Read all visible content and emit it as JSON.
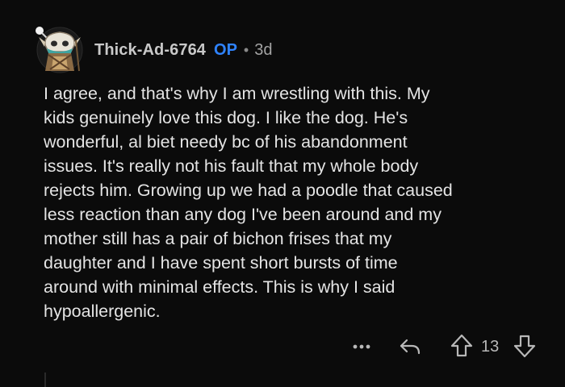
{
  "comment": {
    "author": "Thick-Ad-6764",
    "op_badge": "OP",
    "separator": "•",
    "age": "3d",
    "avatar_icon": "snoo-avatar-icon",
    "lines": [
      "I agree, and that's why I am wrestling with this. My",
      "kids genuinely love this dog. I like the dog. He's",
      "wonderful, al biet needy bc of his abandonment",
      "issues. It's really not his fault that my whole body",
      "rejects him. Growing up we had a poodle that caused",
      "less reaction than any dog I've been around and my",
      "mother still has a pair of bichon frises that my",
      "daughter and I have spent short bursts of time",
      "around with minimal effects. This is why I said",
      "hypoallergenic."
    ]
  },
  "actions": {
    "more_icon": "more-options-icon",
    "reply_icon": "reply-arrow-icon",
    "upvote_icon": "upvote-arrow-icon",
    "score": "13",
    "downvote_icon": "downvote-arrow-icon"
  },
  "colors": {
    "background": "#0b0b0b",
    "text": "#e4e4e4",
    "username": "#c9c9c9",
    "op_badge": "#2f83ff",
    "icon": "#b8b8b8"
  }
}
